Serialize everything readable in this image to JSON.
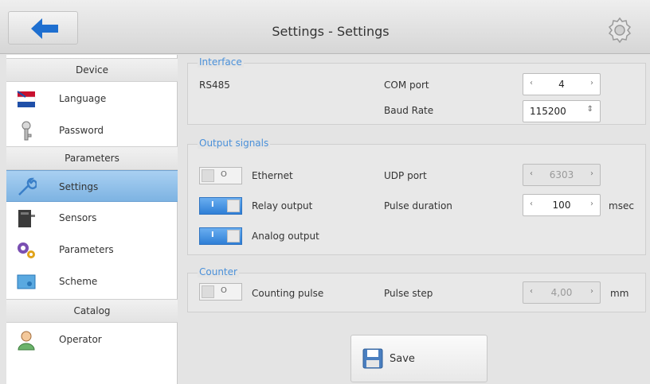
{
  "header": {
    "title": "Settings - Settings"
  },
  "sidebar": {
    "sections": [
      {
        "title": "Device",
        "items": [
          "Language",
          "Password"
        ]
      },
      {
        "title": "Parameters",
        "items": [
          "Settings",
          "Sensors",
          "Parameters",
          "Scheme"
        ]
      },
      {
        "title": "Catalog",
        "items": [
          "Operator"
        ]
      }
    ],
    "active_item": "Settings"
  },
  "interface": {
    "title": "Interface",
    "protocol": "RS485",
    "com_port_label": "COM port",
    "com_port_value": "4",
    "baud_rate_label": "Baud Rate",
    "baud_rate_value": "115200"
  },
  "output_signals": {
    "title": "Output signals",
    "ethernet_label": "Ethernet",
    "ethernet_on": false,
    "relay_label": "Relay output",
    "relay_on": true,
    "analog_label": "Analog output",
    "analog_on": true,
    "udp_port_label": "UDP port",
    "udp_port_value": "6303",
    "pulse_duration_label": "Pulse duration",
    "pulse_duration_value": "100",
    "pulse_duration_unit": "msec"
  },
  "counter": {
    "title": "Counter",
    "counting_pulse_label": "Counting pulse",
    "counting_pulse_on": false,
    "pulse_step_label": "Pulse step",
    "pulse_step_value": "4,00",
    "pulse_step_unit": "mm"
  },
  "toggle_marks": {
    "on": "I",
    "off": "O"
  },
  "arrows": {
    "left": "‹",
    "right": "›",
    "updown": "⇕"
  },
  "save_label": "Save",
  "colors": {
    "accent": "#4a90d9",
    "active_nav": "#7db3e2",
    "toggle_on": "#2f7fd6"
  }
}
